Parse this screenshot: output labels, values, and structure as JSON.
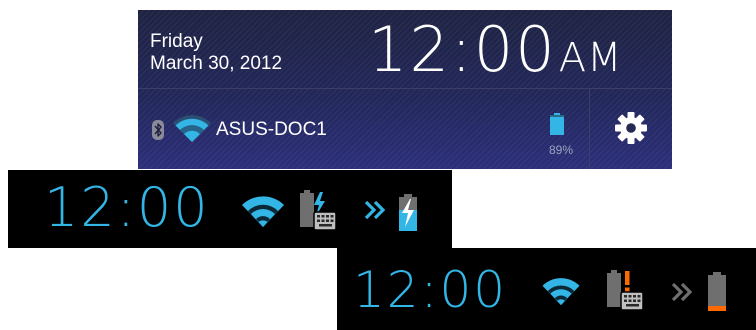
{
  "notification_panel": {
    "day": "Friday",
    "date": "March 30, 2012",
    "time": "12:00",
    "ampm": "AM",
    "bluetooth_icon": "bluetooth-icon",
    "wifi_icon": "wifi-signal-icon",
    "network_name": "ASUS-DOC1",
    "battery_icon": "battery-icon",
    "battery_percent": "89%",
    "settings_icon": "gear-icon"
  },
  "status_bar_charging": {
    "time": "12:00",
    "icons": [
      "wifi-signal-icon",
      "keyboard-dock-battery-charging-icon",
      "chevron-right-icon",
      "tablet-battery-charging-icon"
    ]
  },
  "status_bar_low_battery": {
    "time": "12:00",
    "icons": [
      "wifi-signal-icon",
      "keyboard-dock-battery-warning-icon",
      "chevron-right-icon",
      "tablet-battery-low-icon"
    ]
  },
  "colors": {
    "clock_blue": "#33b5e5",
    "panel_background": "#1c2140",
    "battery_blue": "#33b5e5",
    "warning_orange": "#ff6a00",
    "icon_gray": "#7f7f7f"
  }
}
